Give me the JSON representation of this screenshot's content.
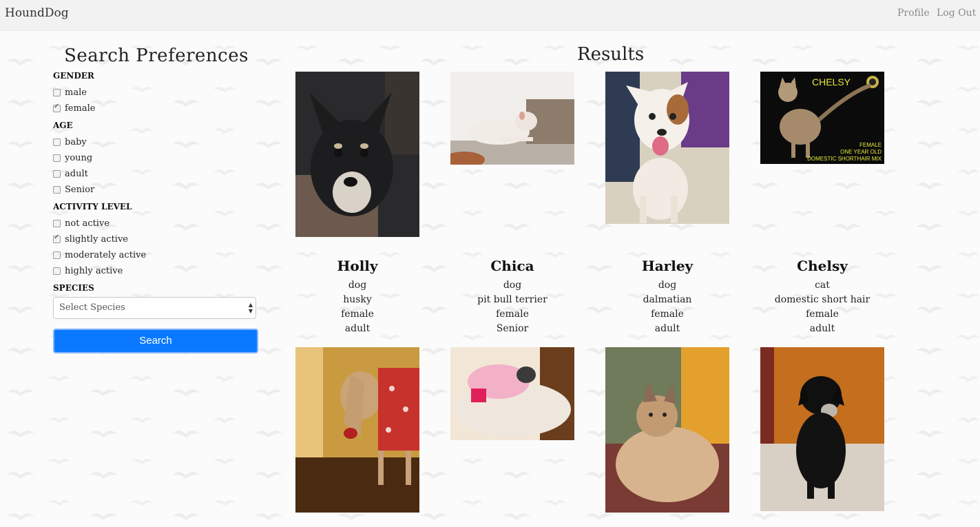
{
  "nav": {
    "brand": "HoundDog",
    "links": [
      "Profile",
      "Log Out"
    ]
  },
  "sidebar": {
    "title": "Search Preferences",
    "sections": [
      {
        "label": "GENDER",
        "options": [
          {
            "label": "male",
            "checked": false
          },
          {
            "label": "female",
            "checked": true
          }
        ]
      },
      {
        "label": "AGE",
        "options": [
          {
            "label": "baby",
            "checked": false
          },
          {
            "label": "young",
            "checked": false
          },
          {
            "label": "adult",
            "checked": false
          },
          {
            "label": "Senior",
            "checked": false
          }
        ]
      },
      {
        "label": "ACTIVITY LEVEL",
        "options": [
          {
            "label": "not active",
            "checked": false
          },
          {
            "label": "slightly active",
            "checked": true
          },
          {
            "label": "moderately active",
            "checked": false
          },
          {
            "label": "highly active",
            "checked": false
          }
        ]
      }
    ],
    "species_label": "SPECIES",
    "species_select": "Select Species",
    "search_button": "Search"
  },
  "results": {
    "title": "Results",
    "pets": [
      {
        "name": "Holly",
        "species": "dog",
        "breed": "husky",
        "gender": "female",
        "age": "adult"
      },
      {
        "name": "Chica",
        "species": "dog",
        "breed": "pit bull terrier",
        "gender": "female",
        "age": "Senior"
      },
      {
        "name": "Harley",
        "species": "dog",
        "breed": "dalmatian",
        "gender": "female",
        "age": "adult"
      },
      {
        "name": "Chelsy",
        "species": "cat",
        "breed": "domestic short hair",
        "gender": "female",
        "age": "adult"
      }
    ],
    "chelsy_photo_text": [
      "CHELSY",
      "FEMALE",
      "ONE YEAR OLD",
      "DOMESTIC SHORTHAIR MIX"
    ]
  },
  "colors": {
    "button": "#0b79ff",
    "navbar": "#f2f2f2"
  }
}
